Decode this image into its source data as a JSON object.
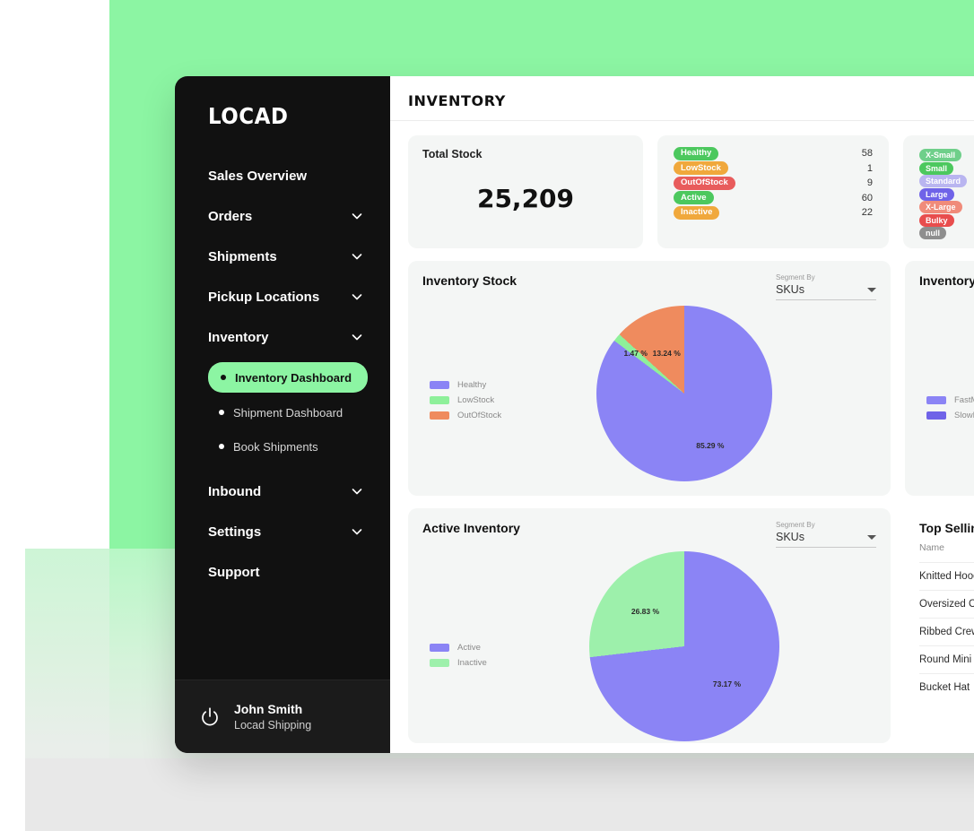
{
  "brand": {
    "logo_text": "LOCAD"
  },
  "sidebar": {
    "items": [
      {
        "label": "Sales Overview",
        "expandable": false
      },
      {
        "label": "Orders",
        "expandable": true
      },
      {
        "label": "Shipments",
        "expandable": true
      },
      {
        "label": "Pickup Locations",
        "expandable": true
      },
      {
        "label": "Inventory",
        "expandable": true
      }
    ],
    "sub_items": [
      {
        "label": "Inventory Dashboard",
        "active": true
      },
      {
        "label": "Shipment Dashboard",
        "active": false
      },
      {
        "label": "Book Shipments",
        "active": false
      }
    ],
    "items_after": [
      {
        "label": "Inbound",
        "expandable": true
      },
      {
        "label": "Settings",
        "expandable": true
      },
      {
        "label": "Support",
        "expandable": false
      }
    ],
    "footer": {
      "icon": "power-icon",
      "user_name": "John Smith",
      "organization": "Locad Shipping"
    },
    "active_color": "#8cf5a3"
  },
  "header": {
    "title": "INVENTORY"
  },
  "total_stock": {
    "label": "Total Stock",
    "value": "25,209"
  },
  "status_card": {
    "rows": [
      {
        "label": "Healthy",
        "count": "58",
        "color": "#4cc85e"
      },
      {
        "label": "LowStock",
        "count": "1",
        "color": "#f0a83c"
      },
      {
        "label": "OutOfStock",
        "count": "9",
        "color": "#e85c5c"
      },
      {
        "label": "Active",
        "count": "60",
        "color": "#4cc85e"
      },
      {
        "label": "Inactive",
        "count": "22",
        "color": "#f0a83c"
      }
    ]
  },
  "size_card": {
    "rows": [
      {
        "label": "X-Small",
        "color": "#6fcf8a"
      },
      {
        "label": "Small",
        "color": "#4cc85e"
      },
      {
        "label": "Standard",
        "color": "#b9b5f0"
      },
      {
        "label": "Large",
        "color": "#6f63e8"
      },
      {
        "label": "X-Large",
        "color": "#f08b7a"
      },
      {
        "label": "Bulky",
        "color": "#e84d4d"
      },
      {
        "label": "null",
        "color": "#8e8e8e"
      }
    ]
  },
  "inventory_stock_panel": {
    "title": "Inventory Stock",
    "segment_label": "Segment By",
    "segment_value": "SKUs"
  },
  "inventory_movement_panel": {
    "title": "Inventory Movement",
    "legend": [
      {
        "label": "FastMoving",
        "color": "#8b84f5"
      },
      {
        "label": "SlowMoving",
        "color": "#6f63e8"
      }
    ]
  },
  "active_inventory_panel": {
    "title": "Active Inventory",
    "segment_label": "Segment By",
    "segment_value": "SKUs"
  },
  "top_selling_panel": {
    "title": "Top Selling SKUs",
    "column_header": "Name",
    "rows": [
      {
        "name": "Knitted Hoodie"
      },
      {
        "name": "Oversized Crewneck"
      },
      {
        "name": "Ribbed Crew Neck Tee"
      },
      {
        "name": "Round Mini Shoulder Bag"
      },
      {
        "name": "Bucket Hat"
      }
    ]
  },
  "chart_data": [
    {
      "type": "pie",
      "title": "Inventory Stock",
      "categories": [
        "Healthy",
        "LowStock",
        "OutOfStock"
      ],
      "values": [
        85.29,
        1.47,
        13.24
      ],
      "labels": [
        "85.29 %",
        "1.47 %",
        "13.24 %"
      ],
      "colors": [
        "#8b84f5",
        "#8ef09a",
        "#ef8b5e"
      ],
      "legend_position": "left",
      "unit": "%"
    },
    {
      "type": "pie",
      "title": "Active Inventory",
      "categories": [
        "Active",
        "Inactive"
      ],
      "values": [
        73.17,
        26.83
      ],
      "labels": [
        "73.17 %",
        "26.83 %"
      ],
      "colors": [
        "#8b84f5",
        "#9df0ab"
      ],
      "legend_position": "left",
      "unit": "%"
    }
  ]
}
